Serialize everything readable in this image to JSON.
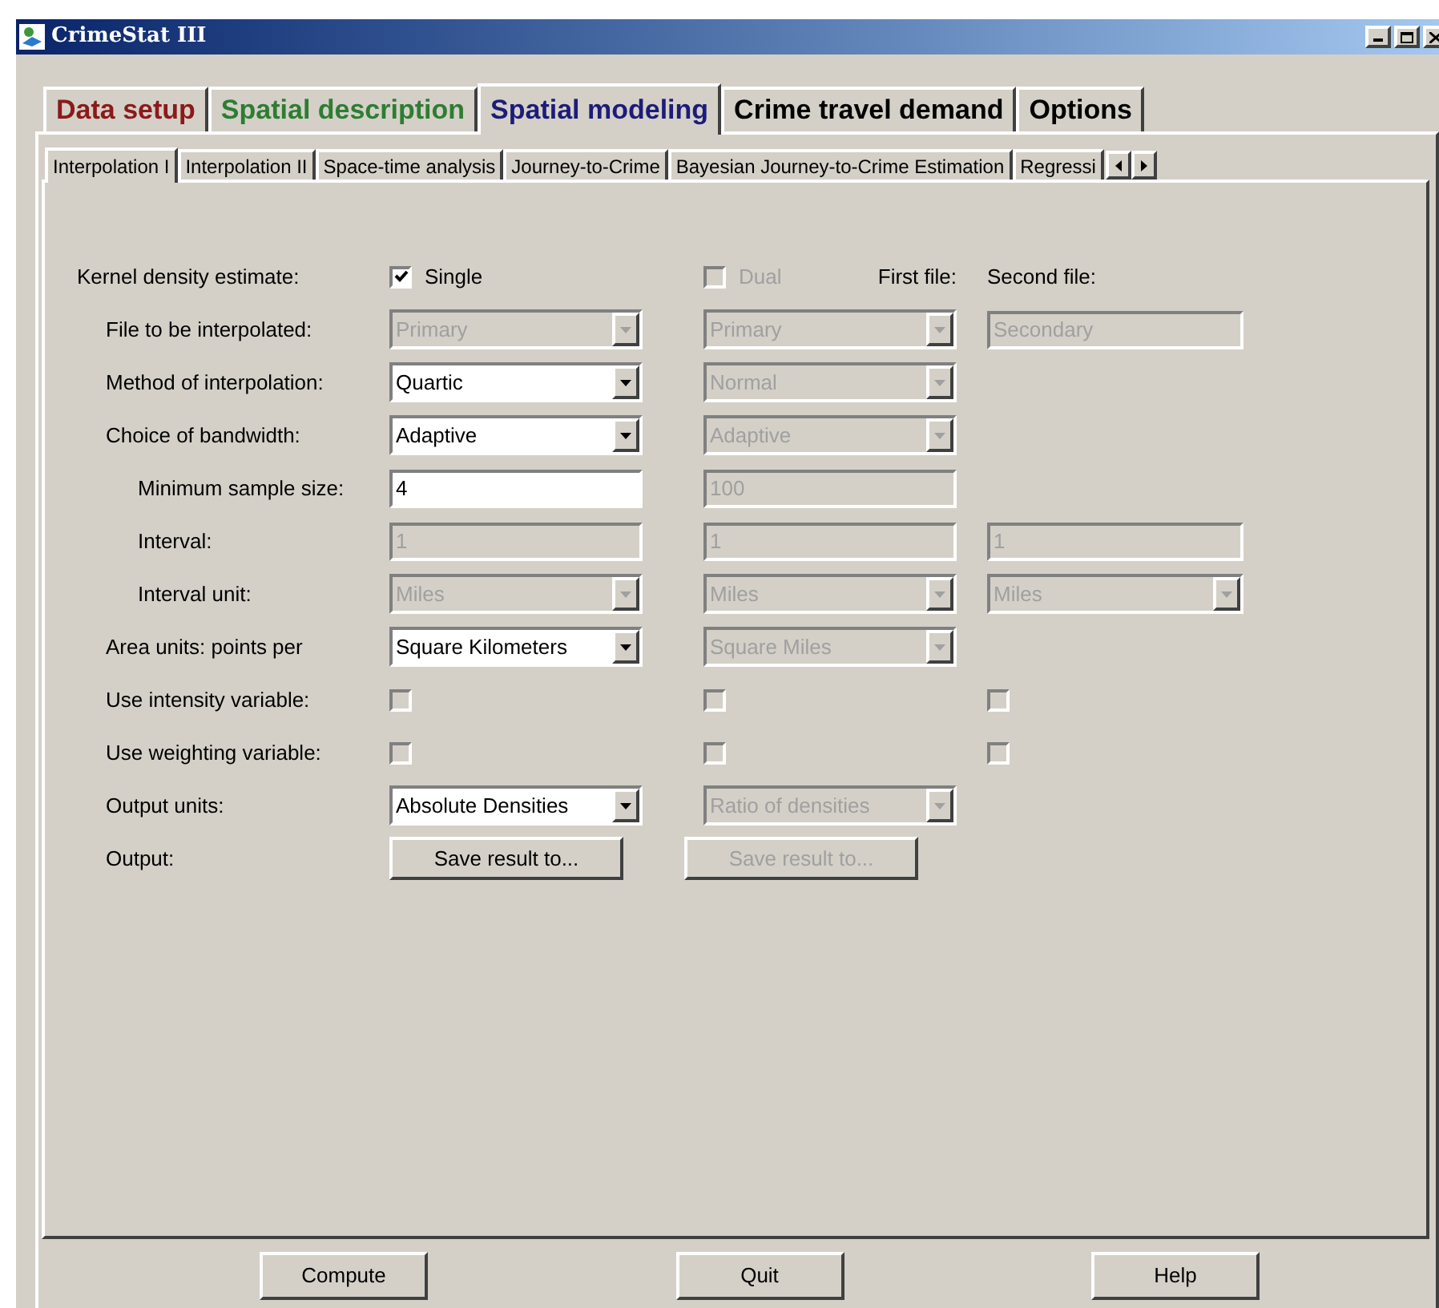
{
  "window": {
    "title": "CrimeStat III"
  },
  "main_tabs": [
    {
      "label": "Data setup",
      "color": "#8b1a1a",
      "selected": false
    },
    {
      "label": "Spatial description",
      "color": "#2e7d32",
      "selected": false
    },
    {
      "label": "Spatial modeling",
      "color": "#1c1c78",
      "selected": true
    },
    {
      "label": "Crime travel demand",
      "color": "#000000",
      "selected": false
    },
    {
      "label": "Options",
      "color": "#000000",
      "selected": false
    }
  ],
  "sub_tabs": [
    {
      "label": "Interpolation I",
      "selected": true
    },
    {
      "label": "Interpolation II",
      "selected": false
    },
    {
      "label": "Space-time analysis",
      "selected": false
    },
    {
      "label": "Journey-to-Crime",
      "selected": false
    },
    {
      "label": "Bayesian Journey-to-Crime Estimation",
      "selected": false
    },
    {
      "label": "Regressi",
      "selected": false
    }
  ],
  "kernel": {
    "label": "Kernel density estimate:",
    "single": {
      "label": "Single",
      "checked": true,
      "disabled": false
    },
    "dual": {
      "label": "Dual",
      "checked": false,
      "disabled": true
    },
    "first_file_header": "First file:",
    "second_file_header": "Second file:"
  },
  "rows": [
    {
      "label": "File to be interpolated:",
      "single": {
        "kind": "dropdown",
        "value": "Primary",
        "disabled": true
      },
      "dual": {
        "kind": "dropdown",
        "value": "Primary",
        "disabled": true
      },
      "second": {
        "kind": "text",
        "value": "Secondary",
        "disabled": true
      }
    },
    {
      "label": "Method of interpolation:",
      "single": {
        "kind": "dropdown",
        "value": "Quartic",
        "disabled": false
      },
      "dual": {
        "kind": "dropdown",
        "value": "Normal",
        "disabled": true
      }
    },
    {
      "label": "Choice of bandwidth:",
      "single": {
        "kind": "dropdown",
        "value": "Adaptive",
        "disabled": false
      },
      "dual": {
        "kind": "dropdown",
        "value": "Adaptive",
        "disabled": true
      },
      "children": [
        {
          "label": "Minimum sample size:",
          "single": {
            "kind": "text",
            "value": "4",
            "disabled": false
          },
          "dual": {
            "kind": "text",
            "value": "100",
            "disabled": true
          }
        },
        {
          "label": "Interval:",
          "single": {
            "kind": "text",
            "value": "1",
            "disabled": true
          },
          "dual": {
            "kind": "text",
            "value": "1",
            "disabled": true
          },
          "second": {
            "kind": "text",
            "value": "1",
            "disabled": true
          }
        },
        {
          "label": "Interval unit:",
          "single": {
            "kind": "dropdown",
            "value": "Miles",
            "disabled": true
          },
          "dual": {
            "kind": "dropdown",
            "value": "Miles",
            "disabled": true
          },
          "second": {
            "kind": "dropdown",
            "value": "Miles",
            "disabled": true
          }
        }
      ]
    },
    {
      "label": "Area units: points per",
      "single": {
        "kind": "dropdown",
        "value": "Square Kilometers",
        "disabled": false
      },
      "dual": {
        "kind": "dropdown",
        "value": "Square Miles",
        "disabled": true
      }
    },
    {
      "label": "Use intensity variable:",
      "single": {
        "kind": "checkbox",
        "checked": false,
        "disabled": true
      },
      "dual": {
        "kind": "checkbox",
        "checked": false,
        "disabled": true
      },
      "second": {
        "kind": "checkbox",
        "checked": false,
        "disabled": true
      }
    },
    {
      "label": "Use weighting variable:",
      "single": {
        "kind": "checkbox",
        "checked": false,
        "disabled": true
      },
      "dual": {
        "kind": "checkbox",
        "checked": false,
        "disabled": true
      },
      "second": {
        "kind": "checkbox",
        "checked": false,
        "disabled": true
      }
    },
    {
      "label": "Output units:",
      "single": {
        "kind": "dropdown",
        "value": "Absolute Densities",
        "disabled": false
      },
      "dual": {
        "kind": "dropdown",
        "value": "Ratio of densities",
        "disabled": true
      }
    },
    {
      "label": "Output:",
      "single": {
        "kind": "button",
        "value": "Save result to...",
        "disabled": false
      },
      "dual": {
        "kind": "button",
        "value": "Save result to...",
        "disabled": true
      }
    }
  ],
  "buttons": [
    "Compute",
    "Quit",
    "Help"
  ]
}
